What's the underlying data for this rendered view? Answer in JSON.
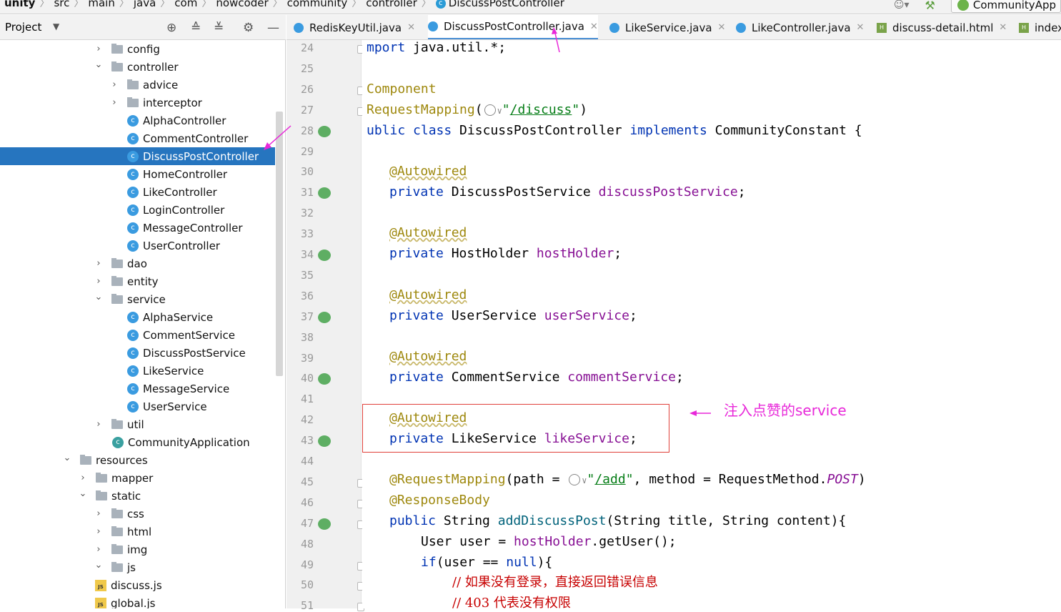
{
  "breadcrumb": {
    "items": [
      "unity",
      "src",
      "main",
      "java",
      "com",
      "nowcoder",
      "community",
      "controller",
      "DiscussPostController"
    ],
    "run_config": "CommunityApp"
  },
  "project_panel": {
    "title": "Project",
    "tree": [
      {
        "label": "config",
        "type": "folder",
        "level": 1,
        "expanded": false
      },
      {
        "label": "controller",
        "type": "folder",
        "level": 1,
        "expanded": true
      },
      {
        "label": "advice",
        "type": "folder",
        "level": 2,
        "expanded": false
      },
      {
        "label": "interceptor",
        "type": "folder",
        "level": 2,
        "expanded": false
      },
      {
        "label": "AlphaController",
        "type": "class",
        "level": 2
      },
      {
        "label": "CommentController",
        "type": "class",
        "level": 2
      },
      {
        "label": "DiscussPostController",
        "type": "class",
        "level": 2,
        "selected": true
      },
      {
        "label": "HomeController",
        "type": "class",
        "level": 2
      },
      {
        "label": "LikeController",
        "type": "class",
        "level": 2
      },
      {
        "label": "LoginController",
        "type": "class",
        "level": 2
      },
      {
        "label": "MessageController",
        "type": "class",
        "level": 2
      },
      {
        "label": "UserController",
        "type": "class",
        "level": 2
      },
      {
        "label": "dao",
        "type": "folder",
        "level": 1,
        "expanded": false
      },
      {
        "label": "entity",
        "type": "folder",
        "level": 1,
        "expanded": false
      },
      {
        "label": "service",
        "type": "folder",
        "level": 1,
        "expanded": true
      },
      {
        "label": "AlphaService",
        "type": "class",
        "level": 2
      },
      {
        "label": "CommentService",
        "type": "class",
        "level": 2
      },
      {
        "label": "DiscussPostService",
        "type": "class",
        "level": 2
      },
      {
        "label": "LikeService",
        "type": "class",
        "level": 2
      },
      {
        "label": "MessageService",
        "type": "class",
        "level": 2
      },
      {
        "label": "UserService",
        "type": "class",
        "level": 2
      },
      {
        "label": "util",
        "type": "folder",
        "level": 1,
        "expanded": false
      },
      {
        "label": "CommunityApplication",
        "type": "app",
        "level": 1
      },
      {
        "label": "resources",
        "type": "folder",
        "level": -1,
        "expanded": true
      },
      {
        "label": "mapper",
        "type": "folder",
        "level": 0,
        "expanded": false
      },
      {
        "label": "static",
        "type": "folder",
        "level": 0,
        "expanded": true
      },
      {
        "label": "css",
        "type": "folder",
        "level": 1,
        "expanded": false
      },
      {
        "label": "html",
        "type": "folder",
        "level": 1,
        "expanded": false
      },
      {
        "label": "img",
        "type": "folder",
        "level": 1,
        "expanded": false
      },
      {
        "label": "js",
        "type": "folder",
        "level": 1,
        "expanded": true
      },
      {
        "label": "discuss.js",
        "type": "js",
        "level": 2
      },
      {
        "label": "global.js",
        "type": "js",
        "level": 2
      }
    ]
  },
  "editor_tabs": [
    {
      "label": "RedisKeyUtil.java",
      "type": "class",
      "active": false
    },
    {
      "label": "DiscussPostController.java",
      "type": "class",
      "active": true
    },
    {
      "label": "LikeService.java",
      "type": "class",
      "active": false
    },
    {
      "label": "LikeController.java",
      "type": "class",
      "active": false
    },
    {
      "label": "discuss-detail.html",
      "type": "html",
      "active": false
    },
    {
      "label": "index",
      "type": "html",
      "active": false
    }
  ],
  "code": {
    "line_numbers": [
      "24",
      "25",
      "26",
      "27",
      "28",
      "29",
      "30",
      "31",
      "32",
      "33",
      "34",
      "35",
      "36",
      "37",
      "38",
      "39",
      "40",
      "41",
      "42",
      "43",
      "44",
      "45",
      "46",
      "47",
      "48",
      "49",
      "50",
      "51"
    ],
    "lines": [
      "mport java.util.*;",
      "",
      "Component",
      "RequestMapping(\"/discuss\")",
      "ublic class DiscussPostController implements CommunityConstant {",
      "",
      "   @Autowired",
      "   private DiscussPostService discussPostService;",
      "",
      "   @Autowired",
      "   private HostHolder hostHolder;",
      "",
      "   @Autowired",
      "   private UserService userService;",
      "",
      "   @Autowired",
      "   private CommentService commentService;",
      "",
      "   @Autowired",
      "   private LikeService likeService;",
      "",
      "   @RequestMapping(path = \"/add\", method = RequestMethod.POST)",
      "   @ResponseBody",
      "   public String addDiscussPost(String title, String content){",
      "       User user = hostHolder.getUser();",
      "       if(user == null){",
      "           // 如果没有登录，直接返回错误信息",
      "           // 403 代表没有权限"
    ]
  },
  "annotation": {
    "note": "注入点赞的service"
  },
  "colors": {
    "selection": "#2675bf",
    "annotation_arrow": "#e828d9",
    "highlight_box": "#e0403a"
  }
}
